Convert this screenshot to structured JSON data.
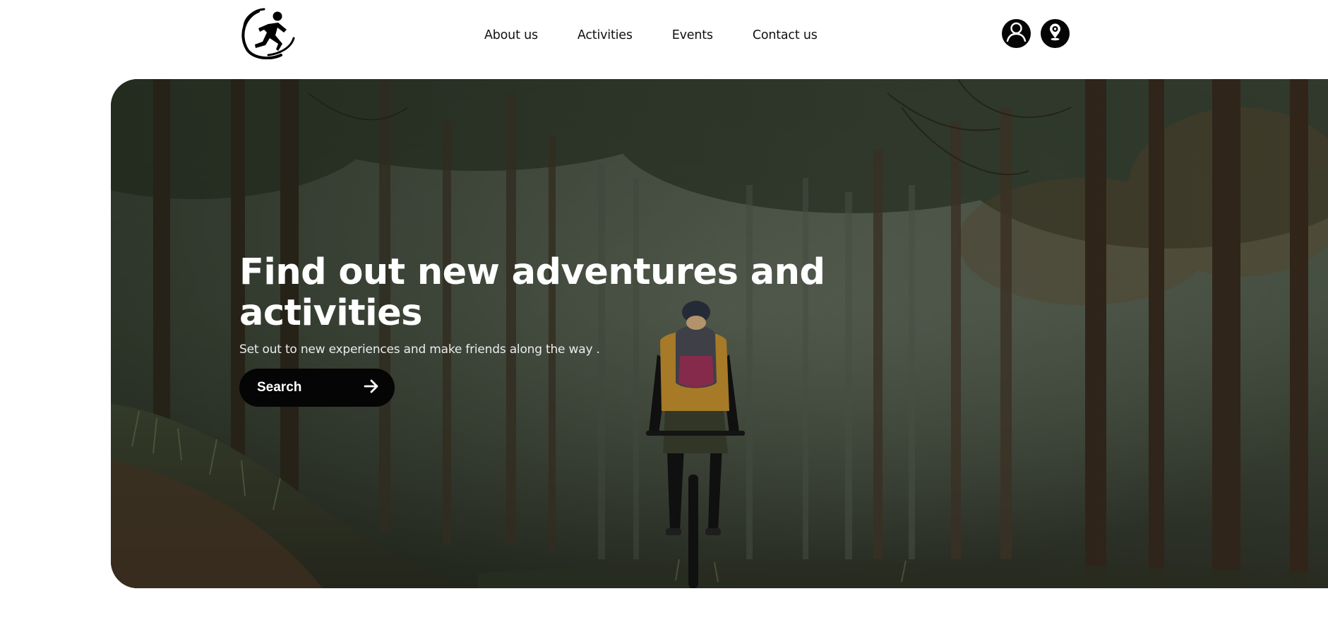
{
  "header": {
    "logo_icon": "runner-logo-icon",
    "nav": {
      "about": "About us",
      "activities": "Activities",
      "events": "Events",
      "contact": "Contact us"
    },
    "actions": {
      "user_icon": "user-icon",
      "location_icon": "location-pin-icon"
    }
  },
  "hero": {
    "title": "Find out new adventures and activities",
    "subtitle": "Set out to new experiences and make friends along the way .",
    "search_label": "Search",
    "search_icon": "arrow-right-icon",
    "image_subject": "cyclist riding through a misty pine forest"
  },
  "colors": {
    "primary": "#050505",
    "text_light": "#ffffff",
    "background": "#ffffff"
  }
}
